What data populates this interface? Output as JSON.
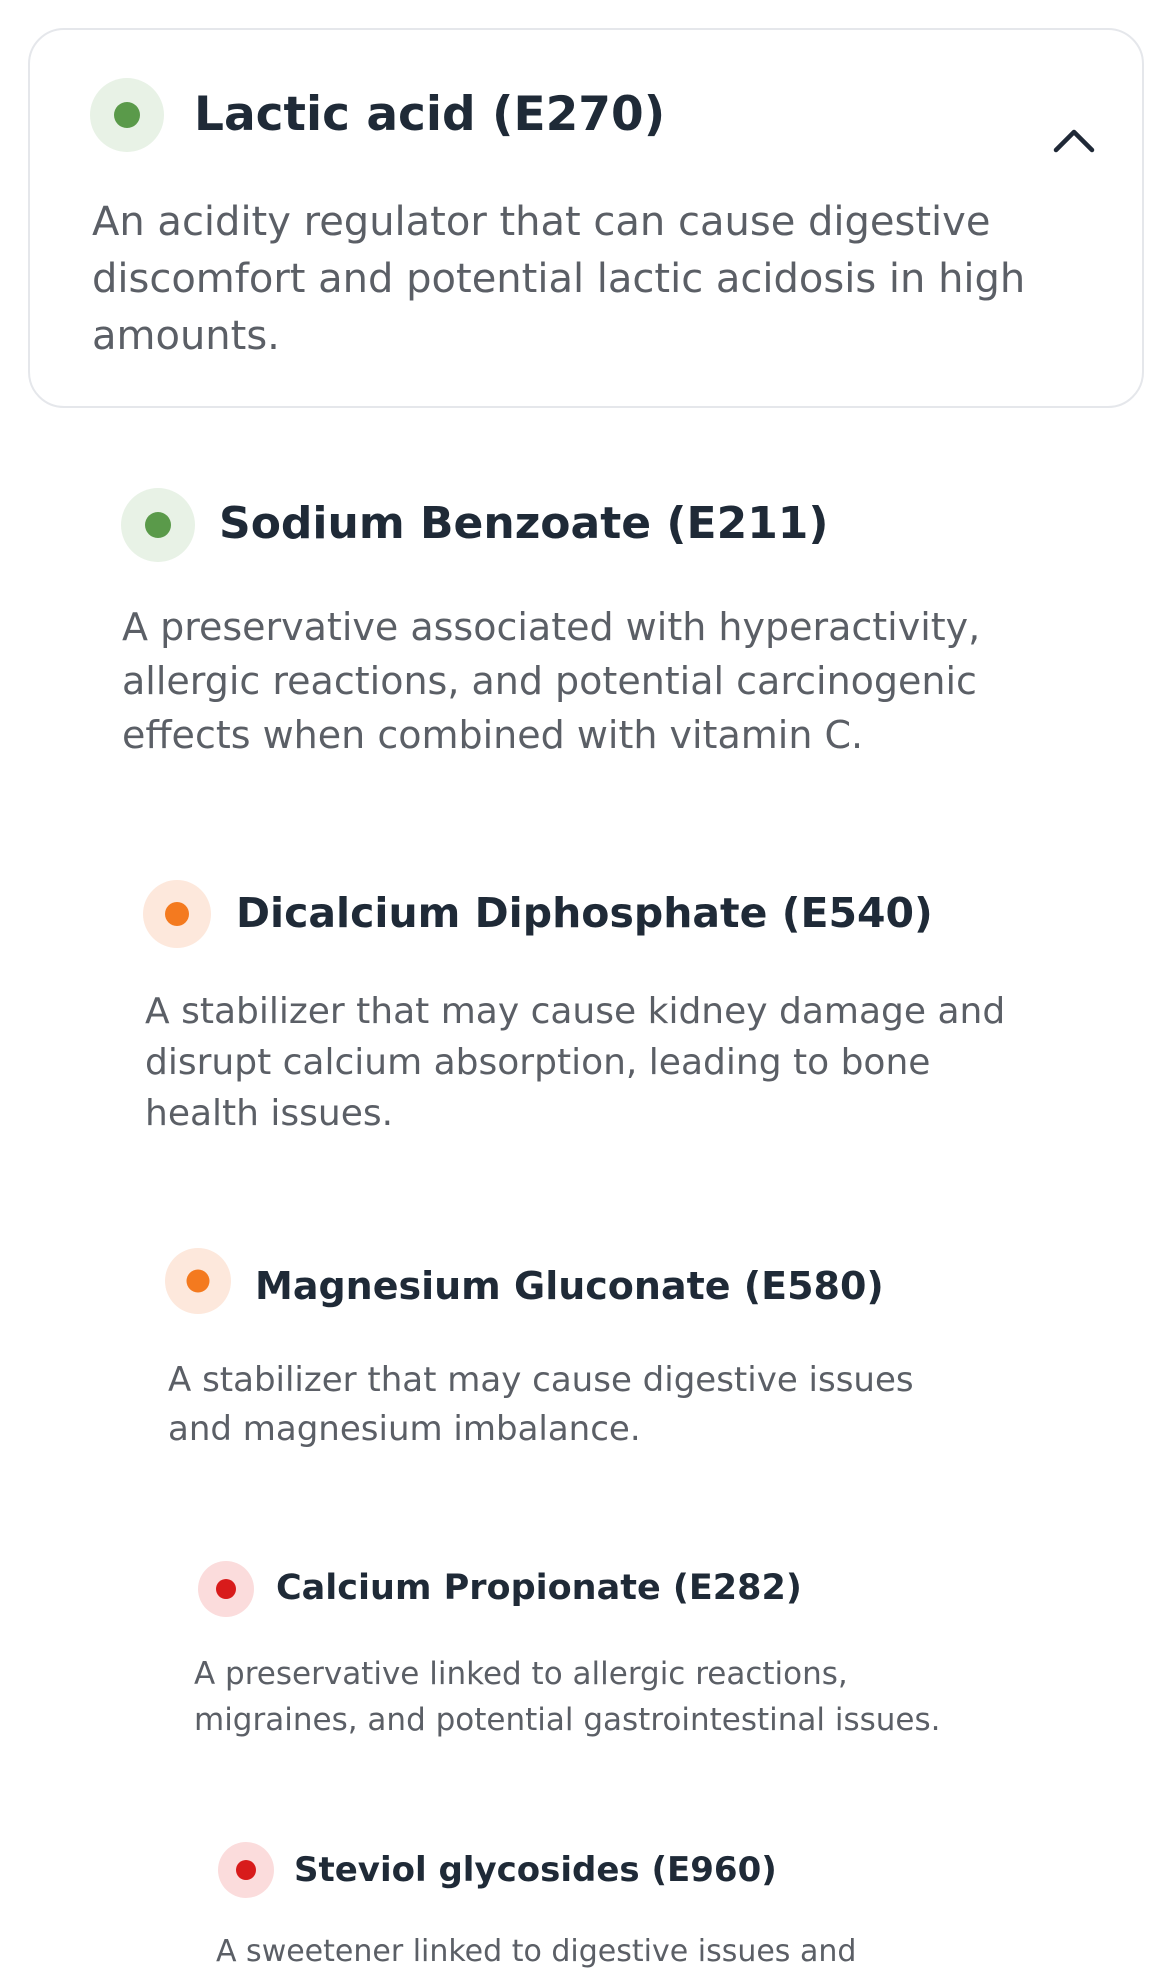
{
  "colors": {
    "safe_dot": "#5a9a4a",
    "safe_bg": "#e8f2e6",
    "moderate_dot": "#f47a1f",
    "moderate_bg": "#fde8dc",
    "high_dot": "#d81b1b",
    "high_bg": "#fbdcdc"
  },
  "expanded_item": {
    "title": "Lactic acid (E270)",
    "description": "An acidity regulator that can cause digestive discomfort and potential lactic acidosis in high amounts.",
    "status": "safe",
    "toggle_icon": "chevron-up-icon"
  },
  "items": [
    {
      "title": "Sodium Benzoate (E211)",
      "description": "A preservative associated with hyperactivity, allergic reactions, and potential carcinogenic effects when combined with vitamin C.",
      "status": "safe"
    },
    {
      "title": "Dicalcium Diphosphate (E540)",
      "description": "A stabilizer that may cause kidney damage and disrupt calcium absorption, leading to bone health issues.",
      "status": "moderate"
    },
    {
      "title": "Magnesium Gluconate (E580)",
      "description": "A stabilizer that may cause digestive issues and magnesium imbalance.",
      "status": "moderate"
    },
    {
      "title": "Calcium Propionate (E282)",
      "description": "A preservative linked to allergic reactions, migraines, and potential gastrointestinal issues.",
      "status": "high"
    },
    {
      "title": "Steviol glycosides (E960)",
      "description": "A sweetener linked to digestive issues and",
      "status": "high"
    }
  ]
}
